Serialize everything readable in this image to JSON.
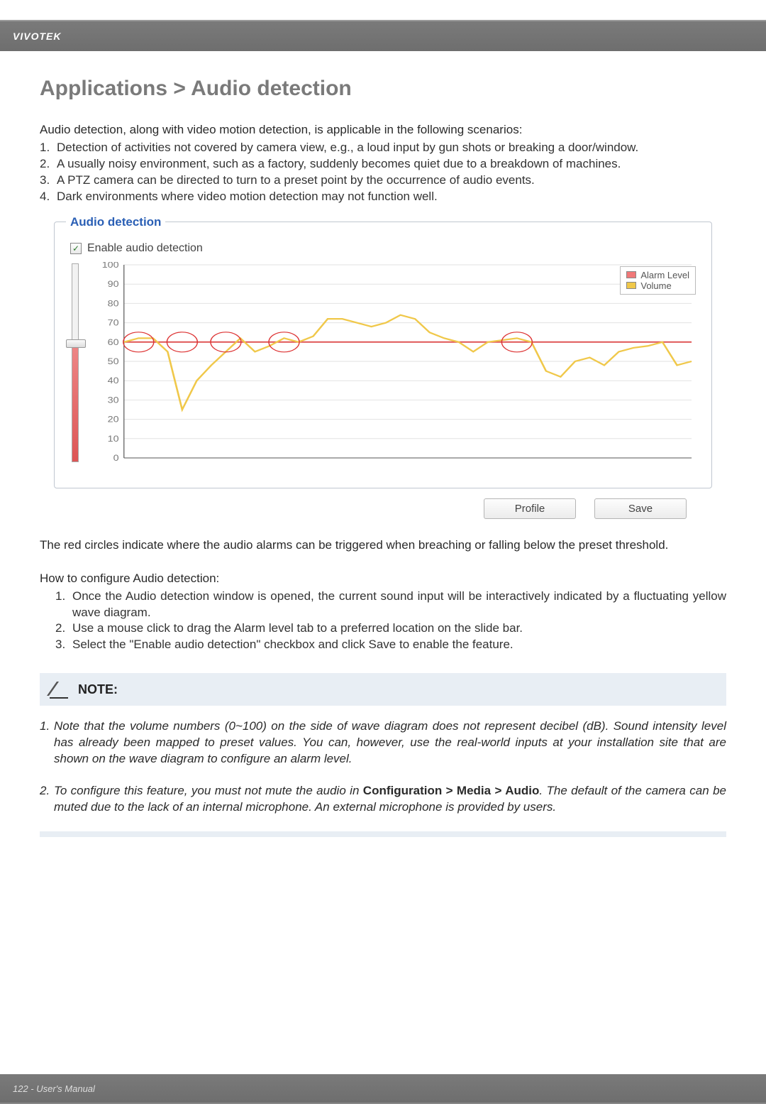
{
  "brand": "VIVOTEK",
  "title": "Applications > Audio detection",
  "intro": "Audio detection, along with video motion detection, is applicable in the following scenarios:",
  "scenarios": [
    "Detection of activities not covered by camera view, e.g., a loud input by gun shots or breaking a door/window.",
    "A usually noisy environment, such as a factory, suddenly becomes quiet due to a breakdown of machines.",
    "A PTZ camera can be directed to turn to a preset point by the occurrence of audio events.",
    "Dark environments where video motion detection may not function well."
  ],
  "panel": {
    "legend": "Audio detection",
    "enable_label": "Enable audio detection",
    "enable_checked": true,
    "legend_items": {
      "alarm": "Alarm Level",
      "volume": "Volume"
    },
    "buttons": {
      "profile": "Profile",
      "save": "Save"
    }
  },
  "chart_data": {
    "type": "line",
    "title": "",
    "xlabel": "",
    "ylabel": "",
    "ylim": [
      0,
      100
    ],
    "y_ticks": [
      0,
      10,
      20,
      30,
      40,
      50,
      60,
      70,
      80,
      90,
      100
    ],
    "alarm_level": 60,
    "series": [
      {
        "name": "Volume",
        "color": "#f0c84a",
        "values": [
          60,
          62,
          62,
          55,
          25,
          40,
          48,
          55,
          62,
          55,
          58,
          62,
          60,
          63,
          72,
          72,
          70,
          68,
          70,
          74,
          72,
          65,
          62,
          60,
          55,
          60,
          61,
          62,
          60,
          45,
          42,
          50,
          52,
          48,
          55,
          57,
          58,
          60,
          48,
          50
        ]
      }
    ],
    "legend": [
      "Alarm Level",
      "Volume"
    ],
    "breach_markers_x": [
      1,
      4,
      7,
      11,
      27
    ]
  },
  "red_circles_text": "The red circles indicate where the audio alarms can be triggered when breaching or falling below the preset threshold.",
  "howto_title": "How to configure Audio detection:",
  "howto": [
    "Once the Audio detection window is opened, the current sound input will be interactively indicated by a fluctuating yellow wave diagram.",
    "Use a mouse click to drag the Alarm level tab to a preferred location on the slide bar.",
    "Select the \"Enable audio detection\" checkbox and click Save to enable the feature."
  ],
  "note": {
    "heading": "NOTE:",
    "items": [
      {
        "pre": "Note that the volume numbers (0~100) on the side of wave diagram does not represent decibel (dB). Sound intensity level has already been mapped to preset values. You can, however, use the real-world inputs at your installation site that are shown on the wave diagram to configure an alarm level.",
        "bold": "",
        "post": ""
      },
      {
        "pre": "To configure this feature, you must not mute the audio in ",
        "bold": "Configuration > Media > Audio",
        "post": ". The default of the camera can be muted due to the lack of an internal microphone. An external microphone is provided by users."
      }
    ]
  },
  "footer": "122 - User's Manual"
}
